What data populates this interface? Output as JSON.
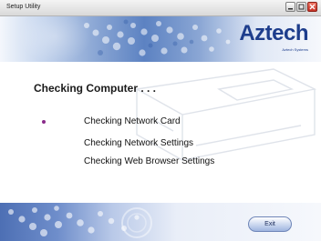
{
  "window": {
    "title": "Setup Utility",
    "controls": {
      "minimize": "minimize-icon",
      "maximize": "maximize-icon",
      "close": "close-icon"
    }
  },
  "brand": {
    "logo": "Aztech",
    "tagline": "Aztech Systems"
  },
  "main": {
    "heading": "Checking Computer . . .",
    "steps": [
      {
        "label": "Checking Network Card",
        "active": true
      },
      {
        "label": "Checking Network Settings",
        "active": false
      },
      {
        "label": "Checking Web Browser Settings",
        "active": false
      }
    ]
  },
  "footer": {
    "exit_label": "Exit"
  },
  "colors": {
    "brand": "#1d3d8c",
    "bullet": "#8a2b8a",
    "close": "#c63024"
  }
}
